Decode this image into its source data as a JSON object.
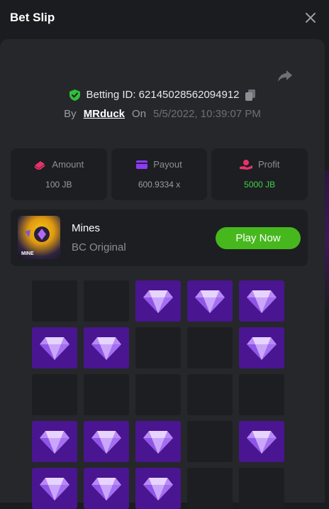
{
  "header": {
    "title": "Bet Slip"
  },
  "bet": {
    "betting_id": "Betting ID: 62145028562094912",
    "by_label": "By",
    "username": "MRduck",
    "on_label": "On",
    "datetime": "5/5/2022, 10:39:07 PM"
  },
  "stats": {
    "amount_label": "Amount",
    "amount_value": "100 JB",
    "payout_label": "Payout",
    "payout_value": "600.9334 x",
    "profit_label": "Profit",
    "profit_value": "5000 JB"
  },
  "game": {
    "name": "Mines",
    "subtitle": "BC Original",
    "thumb_text": "MINE",
    "play_label": "Play Now"
  },
  "grid": {
    "rows": [
      [
        "empty",
        "empty",
        "gem",
        "gem",
        "gem"
      ],
      [
        "gem",
        "gem",
        "empty",
        "empty",
        "gem"
      ],
      [
        "empty",
        "empty",
        "empty",
        "empty",
        "empty"
      ],
      [
        "gem",
        "gem",
        "gem",
        "empty",
        "gem"
      ],
      [
        "gem",
        "gem",
        "gem",
        "empty",
        "empty"
      ]
    ]
  },
  "colors": {
    "background": "#1b1c1f",
    "panel": "#25272b",
    "card": "#1d1e22",
    "gem_tile": "#4a1590",
    "play_button": "#46b81d",
    "profit": "#3fd146",
    "shield": "#2fbf3a"
  },
  "icons": {
    "close": "close-icon",
    "share": "share-icon",
    "shield": "shield-check-icon",
    "copy": "copy-icon",
    "amount": "amount-icon",
    "payout": "wallet-icon",
    "profit": "profit-icon",
    "gem": "gem-icon"
  }
}
